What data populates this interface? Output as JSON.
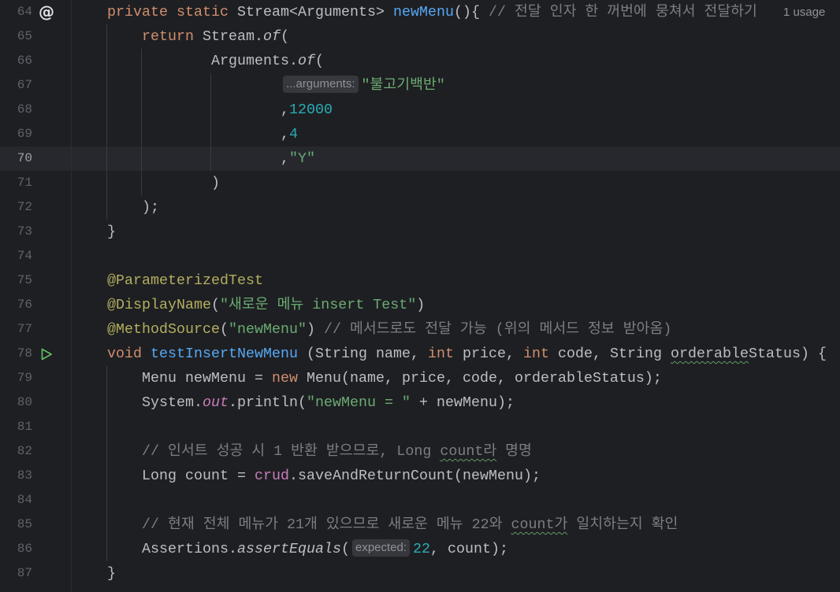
{
  "editor": {
    "caret_line": 70,
    "colors": {
      "bg": "#1E1F22",
      "current-line": "#26282E",
      "plain": "#BCBEC4",
      "keyword": "#CF8E6D",
      "declaration": "#56A8F5",
      "comment": "#7A7E85",
      "string": "#6AAB73",
      "number": "#2AACB8",
      "annotation": "#B3AE60",
      "field": "#C77DBB",
      "line-number": "#5F636B",
      "line-number-current": "#A1A3AB",
      "hint-text": "#8E9199",
      "hint-bg": "#36383D",
      "run-icon": "#5FB865",
      "gutter-icon": "#DFE1E5",
      "typo-underline": "#5E9A68",
      "indent-guide": "#393B40",
      "divider": "#2B2D30"
    },
    "lines": [
      {
        "number": 64,
        "gutter_icon": "at-sign-icon",
        "usage_hint": "1 usage",
        "tokens": [
          {
            "type": "ws",
            "text": "    "
          },
          {
            "type": "keyword",
            "text": "private"
          },
          {
            "type": "plain",
            "text": " "
          },
          {
            "type": "keyword",
            "text": "static"
          },
          {
            "type": "plain",
            "text": " Stream<Arguments> "
          },
          {
            "type": "declaration",
            "text": "newMenu"
          },
          {
            "type": "plain",
            "text": "(){ "
          },
          {
            "type": "comment",
            "text": "// 전달 인자 한 꺼번에 뭉쳐서 전달하기"
          }
        ]
      },
      {
        "number": 65,
        "tokens": [
          {
            "type": "ws",
            "text": "        "
          },
          {
            "type": "keyword",
            "text": "return"
          },
          {
            "type": "plain",
            "text": " Stream."
          },
          {
            "type": "static-call",
            "text": "of"
          },
          {
            "type": "plain",
            "text": "("
          }
        ]
      },
      {
        "number": 66,
        "tokens": [
          {
            "type": "ws",
            "text": "                "
          },
          {
            "type": "plain",
            "text": "Arguments."
          },
          {
            "type": "static-call",
            "text": "of"
          },
          {
            "type": "plain",
            "text": "("
          }
        ]
      },
      {
        "number": 67,
        "tokens": [
          {
            "type": "ws",
            "text": "                        "
          },
          {
            "type": "hint",
            "text": "...arguments:"
          },
          {
            "type": "string",
            "text": "\"불고기백반\""
          }
        ]
      },
      {
        "number": 68,
        "tokens": [
          {
            "type": "ws",
            "text": "                        "
          },
          {
            "type": "plain",
            "text": ","
          },
          {
            "type": "number",
            "text": "12000"
          }
        ]
      },
      {
        "number": 69,
        "tokens": [
          {
            "type": "ws",
            "text": "                        "
          },
          {
            "type": "plain",
            "text": ","
          },
          {
            "type": "number",
            "text": "4"
          }
        ]
      },
      {
        "number": 70,
        "tokens": [
          {
            "type": "ws",
            "text": "                        "
          },
          {
            "type": "plain",
            "text": ","
          },
          {
            "type": "string",
            "text": "\"Y\""
          }
        ]
      },
      {
        "number": 71,
        "tokens": [
          {
            "type": "ws",
            "text": "                "
          },
          {
            "type": "plain",
            "text": ")"
          }
        ]
      },
      {
        "number": 72,
        "tokens": [
          {
            "type": "ws",
            "text": "        "
          },
          {
            "type": "plain",
            "text": ");"
          }
        ]
      },
      {
        "number": 73,
        "tokens": [
          {
            "type": "ws",
            "text": "    "
          },
          {
            "type": "plain",
            "text": "}"
          }
        ]
      },
      {
        "number": 74,
        "tokens": []
      },
      {
        "number": 75,
        "tokens": [
          {
            "type": "ws",
            "text": "    "
          },
          {
            "type": "annotation",
            "text": "@ParameterizedTest"
          }
        ]
      },
      {
        "number": 76,
        "tokens": [
          {
            "type": "ws",
            "text": "    "
          },
          {
            "type": "annotation",
            "text": "@DisplayName"
          },
          {
            "type": "plain",
            "text": "("
          },
          {
            "type": "string",
            "text": "\"새로운 메뉴 insert Test\""
          },
          {
            "type": "plain",
            "text": ")"
          }
        ]
      },
      {
        "number": 77,
        "tokens": [
          {
            "type": "ws",
            "text": "    "
          },
          {
            "type": "annotation",
            "text": "@MethodSource"
          },
          {
            "type": "plain",
            "text": "("
          },
          {
            "type": "string",
            "text": "\"newMenu\""
          },
          {
            "type": "plain",
            "text": ") "
          },
          {
            "type": "comment",
            "text": "// 메서드로도 전달 가능 (위의 메서드 정보 받아옴)"
          }
        ]
      },
      {
        "number": 78,
        "gutter_icon": "run-test-icon",
        "tokens": [
          {
            "type": "ws",
            "text": "    "
          },
          {
            "type": "keyword",
            "text": "void"
          },
          {
            "type": "plain",
            "text": " "
          },
          {
            "type": "declaration",
            "text": "testInsertNewMenu"
          },
          {
            "type": "plain",
            "text": " (String name, "
          },
          {
            "type": "keyword",
            "text": "int"
          },
          {
            "type": "plain",
            "text": " price, "
          },
          {
            "type": "keyword",
            "text": "int"
          },
          {
            "type": "plain",
            "text": " code, String "
          },
          {
            "type": "plain",
            "text": "orderable",
            "typo": true
          },
          {
            "type": "plain",
            "text": "Status) {"
          }
        ]
      },
      {
        "number": 79,
        "tokens": [
          {
            "type": "ws",
            "text": "        "
          },
          {
            "type": "plain",
            "text": "Menu newMenu = "
          },
          {
            "type": "keyword",
            "text": "new"
          },
          {
            "type": "plain",
            "text": " Menu(name, price, code, orderableStatus);"
          }
        ]
      },
      {
        "number": 80,
        "tokens": [
          {
            "type": "ws",
            "text": "        "
          },
          {
            "type": "plain",
            "text": "System."
          },
          {
            "type": "static-field",
            "text": "out"
          },
          {
            "type": "plain",
            "text": ".println("
          },
          {
            "type": "string",
            "text": "\"newMenu = \""
          },
          {
            "type": "plain",
            "text": " + newMenu);"
          }
        ]
      },
      {
        "number": 81,
        "tokens": []
      },
      {
        "number": 82,
        "tokens": [
          {
            "type": "ws",
            "text": "        "
          },
          {
            "type": "comment",
            "text": "// 인서트 성공 시 1 반환 받으므로, Long "
          },
          {
            "type": "comment",
            "text": "count라",
            "typo": true
          },
          {
            "type": "comment",
            "text": " 명명"
          }
        ]
      },
      {
        "number": 83,
        "tokens": [
          {
            "type": "ws",
            "text": "        "
          },
          {
            "type": "plain",
            "text": "Long count = "
          },
          {
            "type": "field",
            "text": "crud"
          },
          {
            "type": "plain",
            "text": ".saveAndReturnCount(newMenu);"
          }
        ]
      },
      {
        "number": 84,
        "tokens": []
      },
      {
        "number": 85,
        "tokens": [
          {
            "type": "ws",
            "text": "        "
          },
          {
            "type": "comment",
            "text": "// 현재 전체 메뉴가 21개 있으므로 새로운 메뉴 22와 "
          },
          {
            "type": "comment",
            "text": "count가",
            "typo": true
          },
          {
            "type": "comment",
            "text": " 일치하는지 확인"
          }
        ]
      },
      {
        "number": 86,
        "tokens": [
          {
            "type": "ws",
            "text": "        "
          },
          {
            "type": "plain",
            "text": "Assertions."
          },
          {
            "type": "static-call",
            "text": "assertEquals"
          },
          {
            "type": "plain",
            "text": "("
          },
          {
            "type": "hint",
            "text": "expected:"
          },
          {
            "type": "number",
            "text": "22"
          },
          {
            "type": "plain",
            "text": ", count);"
          }
        ]
      },
      {
        "number": 87,
        "tokens": [
          {
            "type": "ws",
            "text": "    "
          },
          {
            "type": "plain",
            "text": "}"
          }
        ]
      }
    ]
  }
}
